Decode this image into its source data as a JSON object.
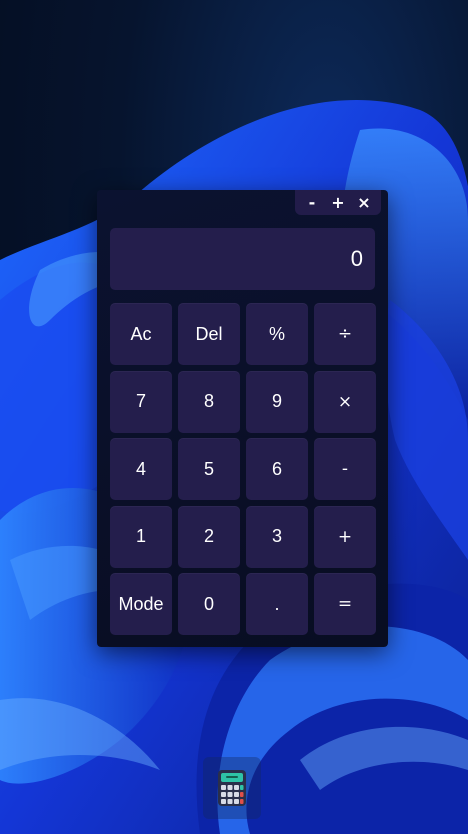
{
  "window": {
    "controls": {
      "minimize": "-",
      "maximize": "+",
      "close": "×"
    }
  },
  "display": {
    "value": "0"
  },
  "keypad": {
    "rows": [
      [
        "Ac",
        "Del",
        "%",
        "÷"
      ],
      [
        "7",
        "8",
        "9",
        "×"
      ],
      [
        "4",
        "5",
        "6",
        "-"
      ],
      [
        "1",
        "2",
        "3",
        "+"
      ],
      [
        "Mode",
        "0",
        ".",
        "="
      ]
    ]
  },
  "taskbar": {
    "app_icon": "calculator-icon"
  },
  "colors": {
    "button_bg": "#241e4c",
    "window_bg": "#0a0f27",
    "accent_teal": "#2ec4a7",
    "text": "#ffffff"
  }
}
